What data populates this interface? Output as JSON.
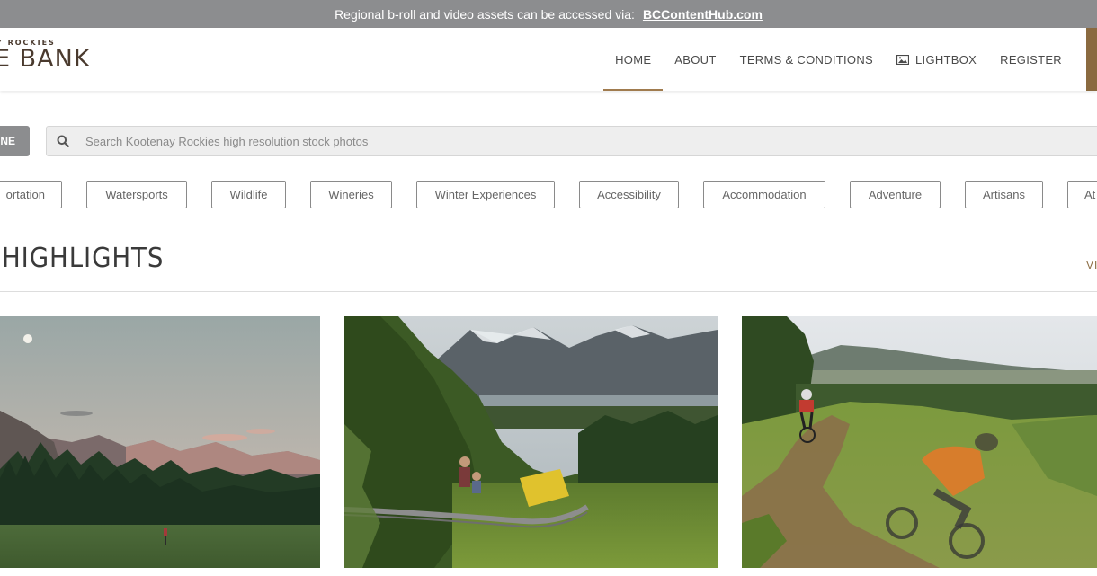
{
  "banner": {
    "text": "Regional b-roll and video assets can be accessed via:",
    "link": "BCContentHub.com"
  },
  "logo": {
    "small_text": "Y ROCKIES",
    "big_text": "E BANK"
  },
  "nav": {
    "home": "HOME",
    "about": "ABOUT",
    "terms": "TERMS & CONDITIONS",
    "lightbox": "LIGHTBOX",
    "register": "REGISTER",
    "active_item": "HOME"
  },
  "search": {
    "scope_label": "NE",
    "placeholder": "Search Kootenay Rockies high resolution stock photos",
    "value": ""
  },
  "categories": [
    "ortation",
    "Watersports",
    "Wildlife",
    "Wineries",
    "Winter Experiences",
    "Accessibility",
    "Accommodation",
    "Adventure",
    "Artisans",
    "At"
  ],
  "section": {
    "title": "HIGHLIGHTS",
    "view_all": "VI"
  },
  "photos": [
    {
      "subject": "golf-course-mountain-sunset"
    },
    {
      "subject": "mountain-coaster-riders"
    },
    {
      "subject": "mountain-bikers-trail"
    }
  ],
  "colors": {
    "banner_bg": "#8c8d8f",
    "accent_brown": "#8a6a40",
    "nav_underline": "#a07b4e",
    "logo_text": "#4a3a2e"
  },
  "icons": {
    "lightbox": "image-icon",
    "search": "search-icon"
  }
}
